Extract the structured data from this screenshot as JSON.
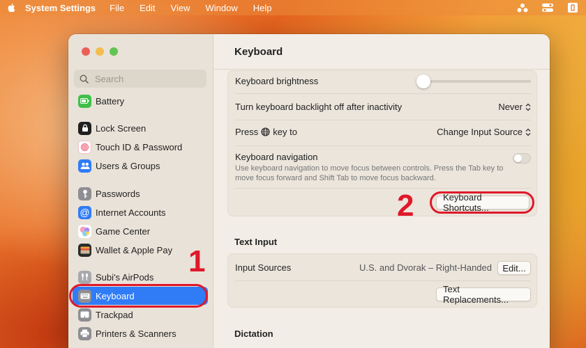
{
  "menubar": {
    "app_name": "System Settings",
    "items": [
      "File",
      "Edit",
      "View",
      "Window",
      "Help"
    ]
  },
  "sidebar": {
    "search_placeholder": "Search",
    "items": [
      {
        "label": "Battery",
        "icon": "battery-icon",
        "color": "#3fbf4a"
      },
      {
        "label": "Lock Screen",
        "icon": "lock-icon",
        "color": "#1f1f1f"
      },
      {
        "label": "Touch ID & Password",
        "icon": "fingerprint-icon",
        "color": "#f25d7a"
      },
      {
        "label": "Users & Groups",
        "icon": "users-icon",
        "color": "#2f7cf6"
      },
      {
        "label": "Passwords",
        "icon": "key-icon",
        "color": "#8e8e93"
      },
      {
        "label": "Internet Accounts",
        "icon": "at-icon",
        "color": "#2f7cf6"
      },
      {
        "label": "Game Center",
        "icon": "game-center-icon",
        "color": "#f4a3c0"
      },
      {
        "label": "Wallet & Apple Pay",
        "icon": "wallet-icon",
        "color": "#2b2b2b"
      },
      {
        "label": "Subi's AirPods",
        "icon": "airpods-icon",
        "color": "#a8a8ad"
      },
      {
        "label": "Keyboard",
        "icon": "keyboard-icon",
        "color": "#8e8e93"
      },
      {
        "label": "Trackpad",
        "icon": "trackpad-icon",
        "color": "#8e8e93"
      },
      {
        "label": "Printers & Scanners",
        "icon": "printer-icon",
        "color": "#8e8e93"
      }
    ],
    "selected_index": 9
  },
  "content": {
    "title": "Keyboard",
    "keyboard_group": {
      "brightness_label": "Keyboard brightness",
      "brightness_level": 0.07,
      "backlight_label": "Turn keyboard backlight off after inactivity",
      "backlight_value": "Never",
      "press_key_prefix": "Press",
      "press_key_suffix": "key to",
      "press_key_value": "Change Input Source",
      "nav_label": "Keyboard navigation",
      "nav_description": "Use keyboard navigation to move focus between controls. Press the Tab key to move focus forward and Shift Tab to move focus backward.",
      "nav_enabled": false,
      "shortcuts_button": "Keyboard Shortcuts..."
    },
    "text_input": {
      "section_title": "Text Input",
      "input_sources_label": "Input Sources",
      "input_sources_value": "U.S. and Dvorak – Right-Handed",
      "edit_button": "Edit...",
      "replacements_button": "Text Replacements..."
    },
    "dictation": {
      "section_title": "Dictation"
    }
  },
  "annotations": {
    "step1": "1",
    "step2": "2",
    "color": "#e0182a"
  }
}
